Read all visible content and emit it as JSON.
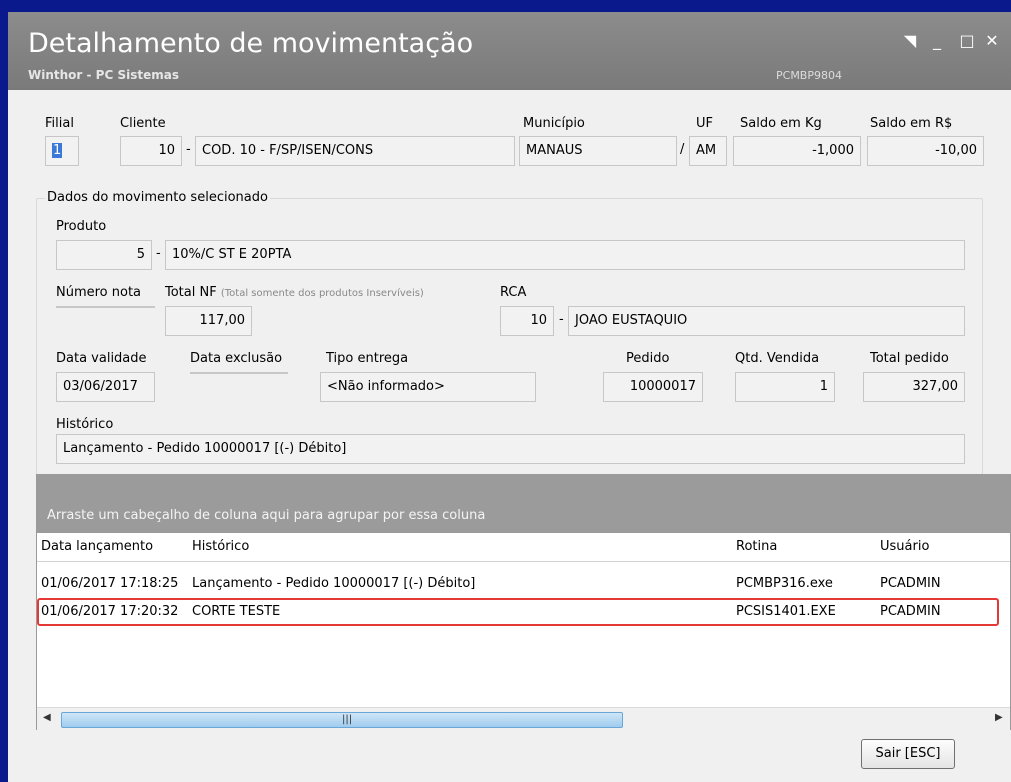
{
  "window": {
    "title": "Detalhamento de movimentação",
    "subtitle": "Winthor - PC Sistemas",
    "code": "PCMBP9804"
  },
  "header": {
    "filial_label": "Filial",
    "filial_value": "1",
    "cliente_label": "Cliente",
    "cliente_code": "10",
    "cliente_name": "COD. 10 - F/SP/ISEN/CONS",
    "municipio_label": "Município",
    "municipio_value": "MANAUS",
    "uf_label": "UF",
    "uf_value": "AM",
    "saldo_kg_label": "Saldo em Kg",
    "saldo_kg_value": "-1,000",
    "saldo_rs_label": "Saldo em R$",
    "saldo_rs_value": "-10,00"
  },
  "movimento": {
    "group_title": "Dados do movimento selecionado",
    "produto_label": "Produto",
    "produto_code": "5",
    "produto_name": "10%/C ST E 20PTA",
    "numero_nota_label": "Número nota",
    "numero_nota_value": "",
    "total_nf_label": "Total NF",
    "total_nf_hint": "(Total somente dos produtos Inservíveis)",
    "total_nf_value": "117,00",
    "rca_label": "RCA",
    "rca_code": "10",
    "rca_name": "JOAO EUSTAQUIO",
    "data_validade_label": "Data validade",
    "data_validade_value": "03/06/2017",
    "data_exclusao_label": "Data exclusão",
    "data_exclusao_value": "",
    "tipo_entrega_label": "Tipo entrega",
    "tipo_entrega_value": "<Não informado>",
    "pedido_label": "Pedido",
    "pedido_value": "10000017",
    "qtd_vendida_label": "Qtd. Vendida",
    "qtd_vendida_value": "1",
    "total_pedido_label": "Total pedido",
    "total_pedido_value": "327,00",
    "historico_label": "Histórico",
    "historico_value": "Lançamento - Pedido 10000017 [(-) Débito]",
    "dash": "-"
  },
  "grid": {
    "group_hint": "Arraste um cabeçalho de coluna aqui para agrupar por essa coluna",
    "columns": [
      "Data lançamento",
      "Histórico",
      "Rotina",
      "Usuário"
    ],
    "rows": [
      [
        "01/06/2017 17:18:25",
        "Lançamento - Pedido 10000017 [(-) Débito]",
        "PCMBP316.exe",
        "PCADMIN"
      ],
      [
        "01/06/2017 17:20:32",
        "CORTE TESTE",
        "PCSIS1401.EXE",
        "PCADMIN"
      ]
    ]
  },
  "buttons": {
    "exit": "Sair [ESC]"
  },
  "colors": {
    "title_bar": "#7f7f7f",
    "highlight": "#e53935",
    "left_border": "#0a1a8c"
  }
}
